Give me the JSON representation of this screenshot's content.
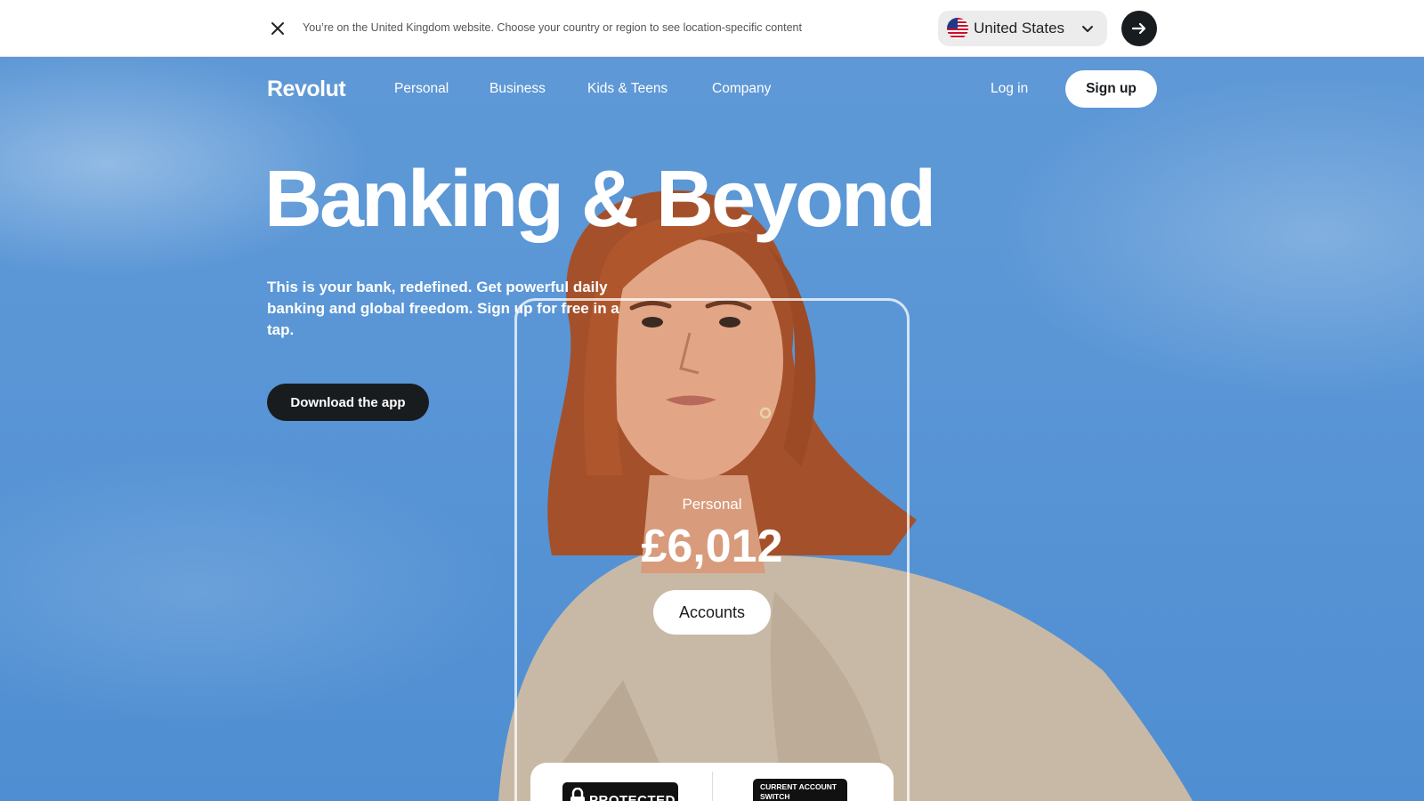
{
  "region_banner": {
    "message": "You’re on the United Kingdom website. Choose your country or region to see location-specific content",
    "selected_country": "United States",
    "flag_icon": "us-flag-icon",
    "close_icon": "close-icon",
    "go_icon": "arrow-right-icon"
  },
  "nav": {
    "logo": "Revolut",
    "items": [
      "Personal",
      "Business",
      "Kids & Teens",
      "Company"
    ],
    "login_label": "Log in",
    "signup_label": "Sign up"
  },
  "hero": {
    "headline": "Banking & Beyond",
    "subtext": "This is your bank, redefined. Get powerful daily banking and global freedom. Sign up for free in a tap.",
    "download_label": "Download the app"
  },
  "account_card": {
    "label": "Personal",
    "balance": "£6,012",
    "accounts_label": "Accounts"
  },
  "badges": {
    "protected_text": "PROTECTED",
    "cass_text": "CURRENT ACCOUNT SWITCH"
  },
  "colors": {
    "sky": "#5a96d6",
    "dark": "#191c1f",
    "white": "#ffffff"
  }
}
